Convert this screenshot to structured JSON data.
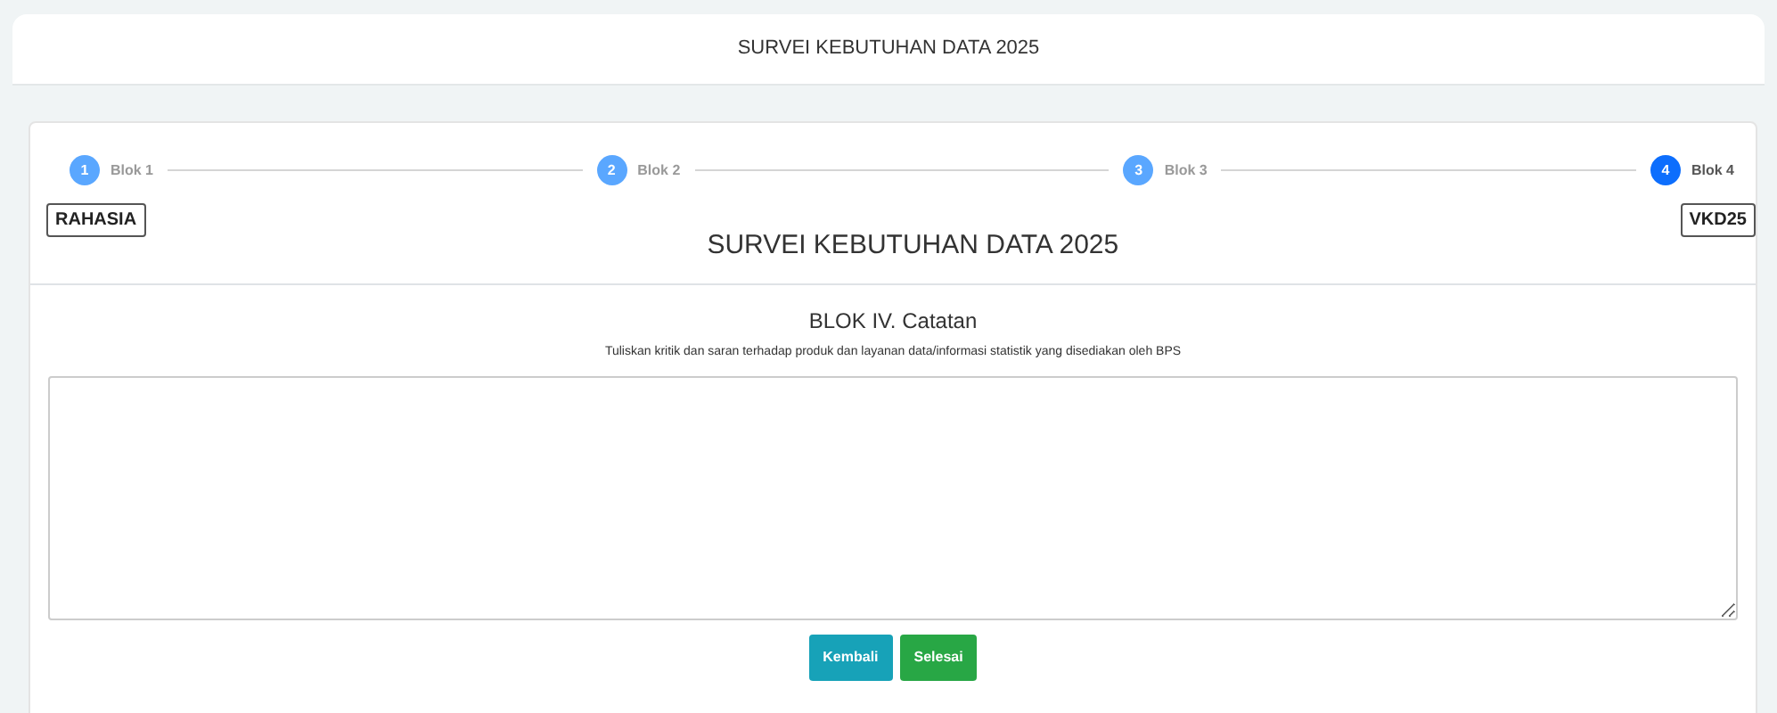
{
  "header": {
    "title": "SURVEI KEBUTUHAN DATA 2025"
  },
  "steps": [
    {
      "number": "1",
      "label": "Blok 1",
      "selected": false
    },
    {
      "number": "2",
      "label": "Blok 2",
      "selected": false
    },
    {
      "number": "3",
      "label": "Blok 3",
      "selected": false
    },
    {
      "number": "4",
      "label": "Blok 4",
      "selected": true
    }
  ],
  "tags": {
    "left": "RAHASIA",
    "right": "VKD25"
  },
  "form_title": "SURVEI KEBUTUHAN DATA 2025",
  "section": {
    "title": "BLOK IV. Catatan",
    "instruction": "Tuliskan kritik dan saran terhadap produk dan layanan data/informasi statistik yang disediakan oleh BPS"
  },
  "buttons": [
    {
      "label": "Kembali",
      "kind": "info"
    },
    {
      "label": "Selesai",
      "kind": "success"
    }
  ]
}
